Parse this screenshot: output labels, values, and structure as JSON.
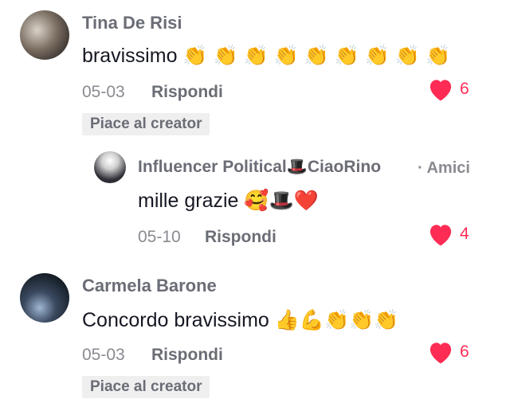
{
  "comments": [
    {
      "author": "Tina De Risi",
      "text": "bravissimo 👏 👏 👏 👏 👏 👏 👏 👏 👏",
      "date": "05-03",
      "reply_label": "Rispondi",
      "likes": "6",
      "badge": "Piace al creator",
      "avatar": "group-photo"
    },
    {
      "author": "Influencer Political🎩CiaoRino",
      "relation": "· Amici",
      "text": "mille grazie 🥰🎩❤️",
      "date": "05-10",
      "reply_label": "Rispondi",
      "likes": "4",
      "avatar": "portrait-photo"
    },
    {
      "author": "Carmela Barone",
      "text": "Concordo bravissimo 👍💪👏👏👏",
      "date": "05-03",
      "reply_label": "Rispondi",
      "likes": "6",
      "badge": "Piace al creator",
      "avatar": "night-photo"
    }
  ],
  "colors": {
    "like": "#fe2c55",
    "secondary_text": "#8a8b91",
    "name_text": "#6b6d76",
    "badge_bg": "#efeff0"
  },
  "icons": [
    "heart-icon"
  ]
}
